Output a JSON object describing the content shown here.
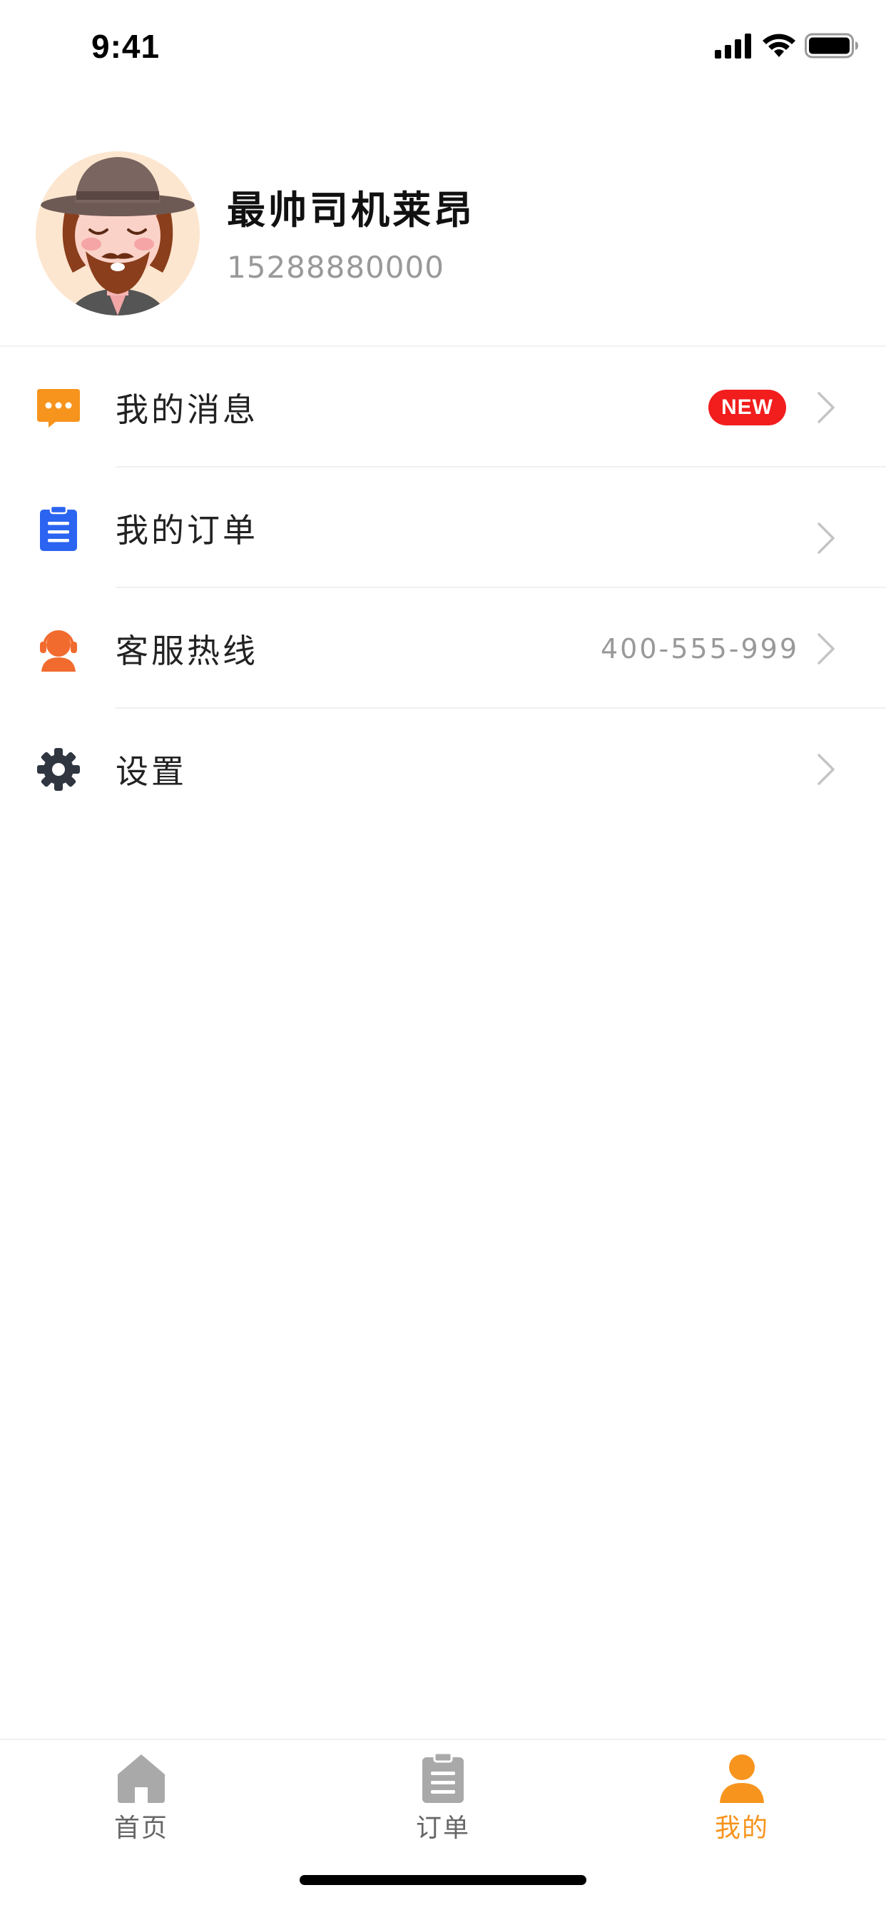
{
  "status_bar": {
    "time": "9:41"
  },
  "profile": {
    "name": "最帅司机莱昂",
    "phone": "15288880000"
  },
  "menu": {
    "items": [
      {
        "label": "我的消息",
        "icon": "message-bubble-icon",
        "badge": "NEW"
      },
      {
        "label": "我的订单",
        "icon": "clipboard-list-icon"
      },
      {
        "label": "客服热线",
        "icon": "customer-service-icon",
        "value": "400-555-999"
      },
      {
        "label": "设置",
        "icon": "gear-icon"
      }
    ]
  },
  "tab_bar": {
    "tabs": [
      {
        "label": "首页",
        "icon": "home-icon",
        "active": false
      },
      {
        "label": "订单",
        "icon": "order-clipboard-icon",
        "active": false
      },
      {
        "label": "我的",
        "icon": "user-icon",
        "active": true
      }
    ]
  },
  "colors": {
    "accent": "#f7941d",
    "badge_red": "#f21d1d",
    "order_blue": "#2b64f0",
    "service_orange": "#f26b2e",
    "gear_dark": "#2f3640",
    "inactive_icon": "#a9a9a9"
  }
}
